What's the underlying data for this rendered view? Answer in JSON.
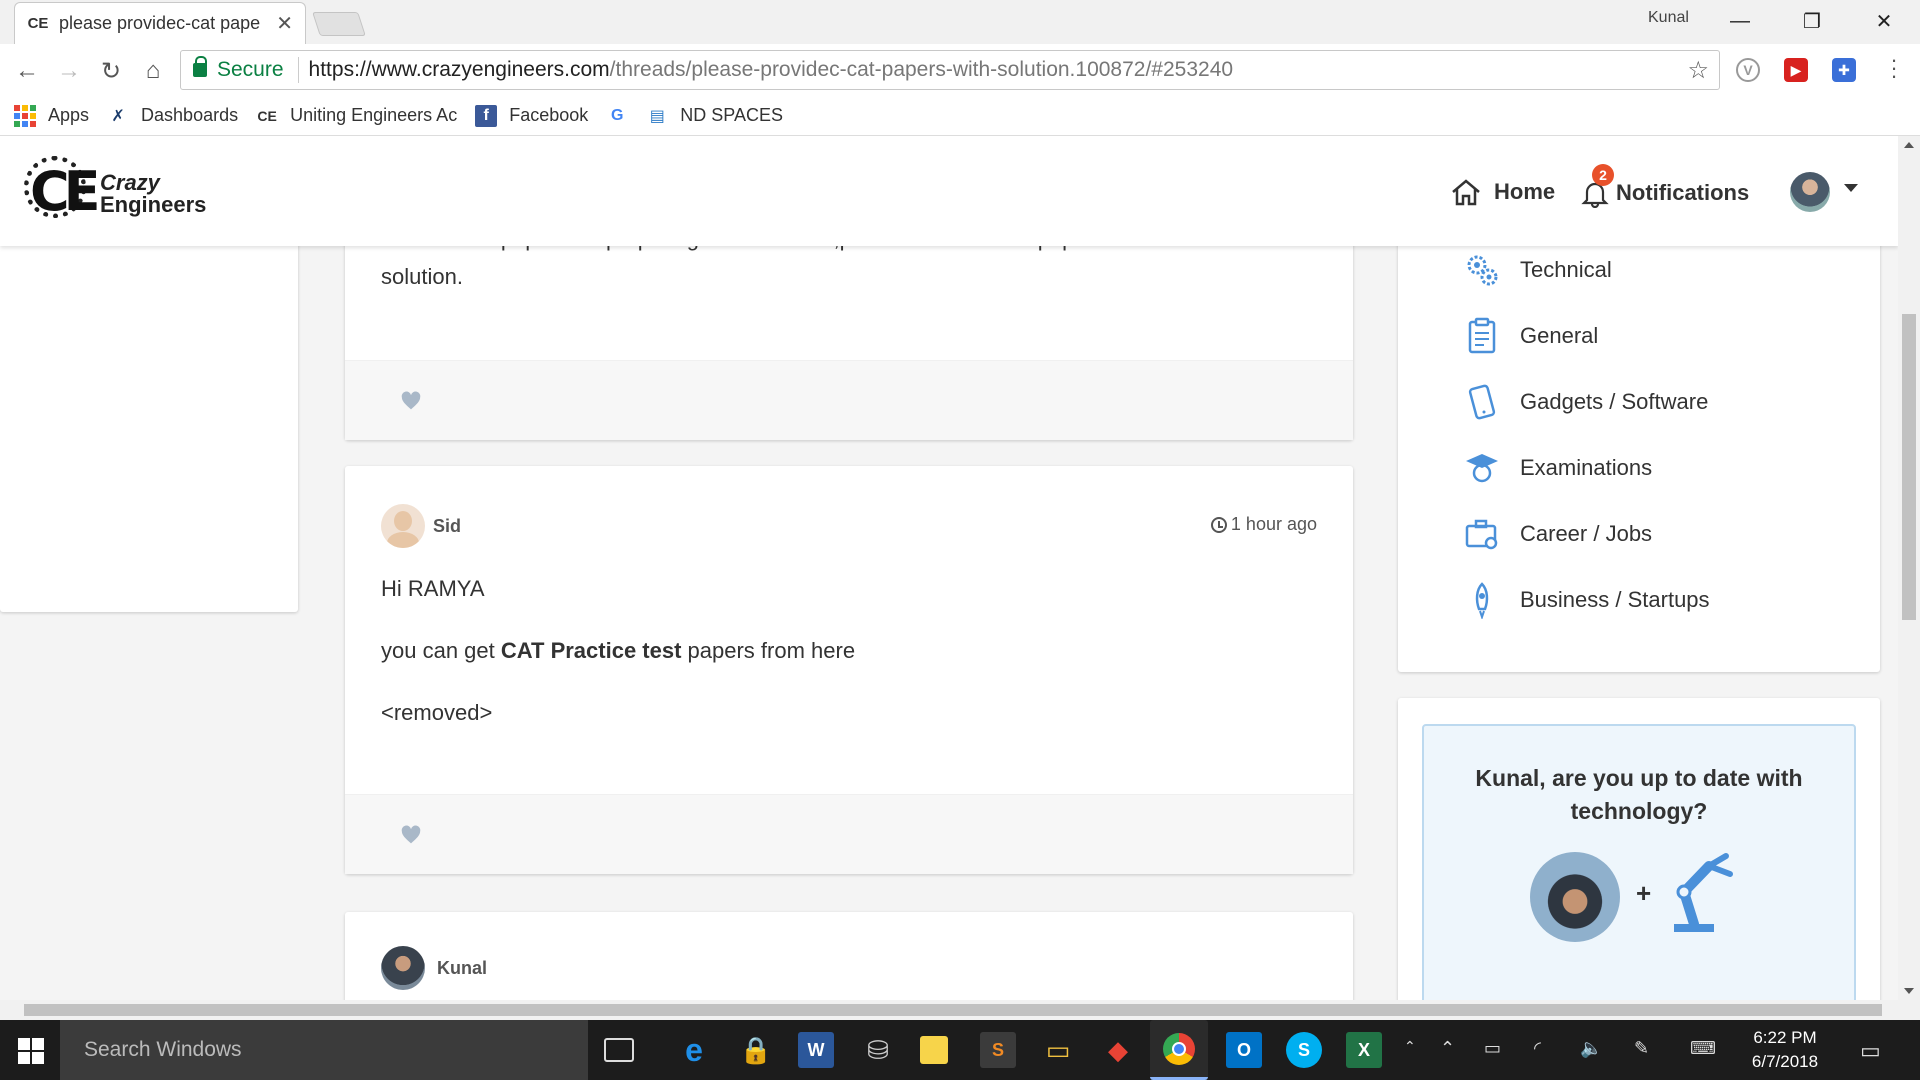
{
  "browser": {
    "tab_title": "please providec-cat pape",
    "tab_favicon": "CE",
    "profile_name": "Kunal",
    "secure_label": "Secure",
    "url_host": "https://www.crazyengineers.com",
    "url_path": "/threads/please-providec-cat-papers-with-solution.100872/#253240",
    "bookmarks": [
      {
        "label": "Apps",
        "icon": "apps-grid-icon"
      },
      {
        "label": "Dashboards",
        "icon": "dashboards-icon"
      },
      {
        "label": "Uniting Engineers Ac",
        "icon": "ce-icon"
      },
      {
        "label": "Facebook",
        "icon": "facebook-icon"
      },
      {
        "label": "",
        "icon": "google-icon"
      },
      {
        "label": "ND SPACES",
        "icon": "nd-spaces-icon"
      }
    ]
  },
  "site": {
    "logo_line1": "Crazy",
    "logo_line2": "Engineers",
    "nav_home": "Home",
    "nav_notifications": "Notifications",
    "notification_count": "2"
  },
  "posts": [
    {
      "text": "I want e-cat papers for preparing for the exam ,please send me the papers with solution."
    },
    {
      "author": "Sid",
      "time": "1 hour ago",
      "line1": "Hi RAMYA",
      "line2_pre": "you can get ",
      "line2_bold": "CAT Practice test",
      "line2_post": " papers from here",
      "line3": "<removed>"
    },
    {
      "author": "Kunal"
    }
  ],
  "categories": [
    {
      "label": "Technical",
      "icon": "gears-icon"
    },
    {
      "label": "General",
      "icon": "clipboard-icon"
    },
    {
      "label": "Gadgets / Software",
      "icon": "phone-icon"
    },
    {
      "label": "Examinations",
      "icon": "graduate-icon"
    },
    {
      "label": "Career / Jobs",
      "icon": "briefcase-icon"
    },
    {
      "label": "Business / Startups",
      "icon": "rocket-icon"
    }
  ],
  "promo": {
    "title": "Kunal, are you up to date with technology?",
    "plus": "+"
  },
  "taskbar": {
    "search_placeholder": "Search Windows",
    "time": "6:22 PM",
    "date": "6/7/2018"
  },
  "colors": {
    "secure_green": "#0b8043",
    "badge_orange": "#e8512a",
    "icon_blue": "#4a90d9"
  }
}
